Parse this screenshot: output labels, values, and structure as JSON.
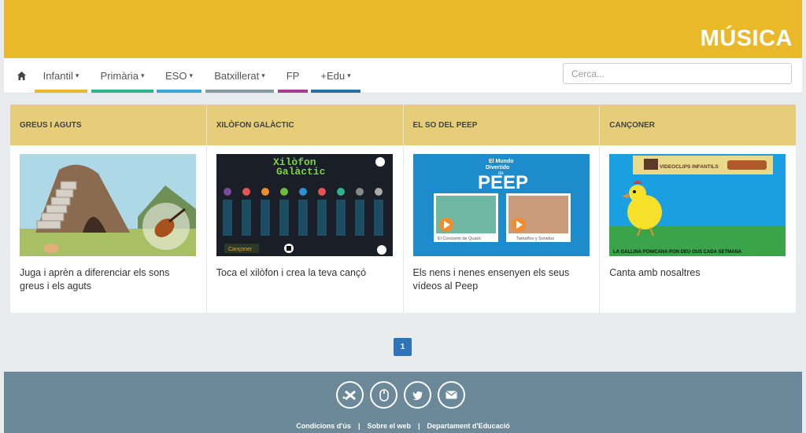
{
  "header": {
    "title": "MÚSICA",
    "brand_color": "#e9b92a"
  },
  "nav": {
    "home_icon": "home-icon",
    "items": [
      {
        "label": "Infantil",
        "caret": "▾",
        "color": "#e9b92a"
      },
      {
        "label": "Primària",
        "caret": "▾",
        "color": "#2fb38e"
      },
      {
        "label": "ESO",
        "caret": "▾",
        "color": "#3aa6d9"
      },
      {
        "label": "Batxillerat",
        "caret": "▾",
        "color": "#879aa3"
      },
      {
        "label": "FP",
        "caret": "",
        "color": "#a63c8f"
      },
      {
        "label": "+Edu",
        "caret": "▾",
        "color": "#2a6fa2"
      }
    ],
    "search_placeholder": "Cerca..."
  },
  "cards": [
    {
      "title": "GREUS I AGUTS",
      "text": "Juga i aprèn a diferenciar els sons greus i els aguts"
    },
    {
      "title": "XILÒFON GALÀCTIC",
      "text": "Toca el xilòfon i crea la teva cançó",
      "img_text": [
        "Xilòfon",
        "Galàctic",
        "Cançoner"
      ]
    },
    {
      "title": "EL SO DEL PEEP",
      "text": "Els nens i nenes ensenyen els seus vídeos al Peep",
      "img_text": [
        "El Mundo",
        "Divertido",
        "de",
        "PEEP",
        "El Concierto de Quack",
        "Tamaños y Sonidos"
      ]
    },
    {
      "title": "CANÇONER",
      "text": "Canta amb nosaltres",
      "img_text": [
        "VIDEOCLIPS INFANTILS",
        "LA GALLINA PONICANA PON DEU OUS CADA SETMANA"
      ]
    }
  ],
  "pagination": {
    "current": "1"
  },
  "footer": {
    "social_icons": [
      "xtec-icon",
      "mouse-icon",
      "twitter-icon",
      "email-icon"
    ],
    "links": [
      "Condicions d'ús",
      "Sobre el web",
      "Departament d'Educació"
    ],
    "separator": "|"
  }
}
